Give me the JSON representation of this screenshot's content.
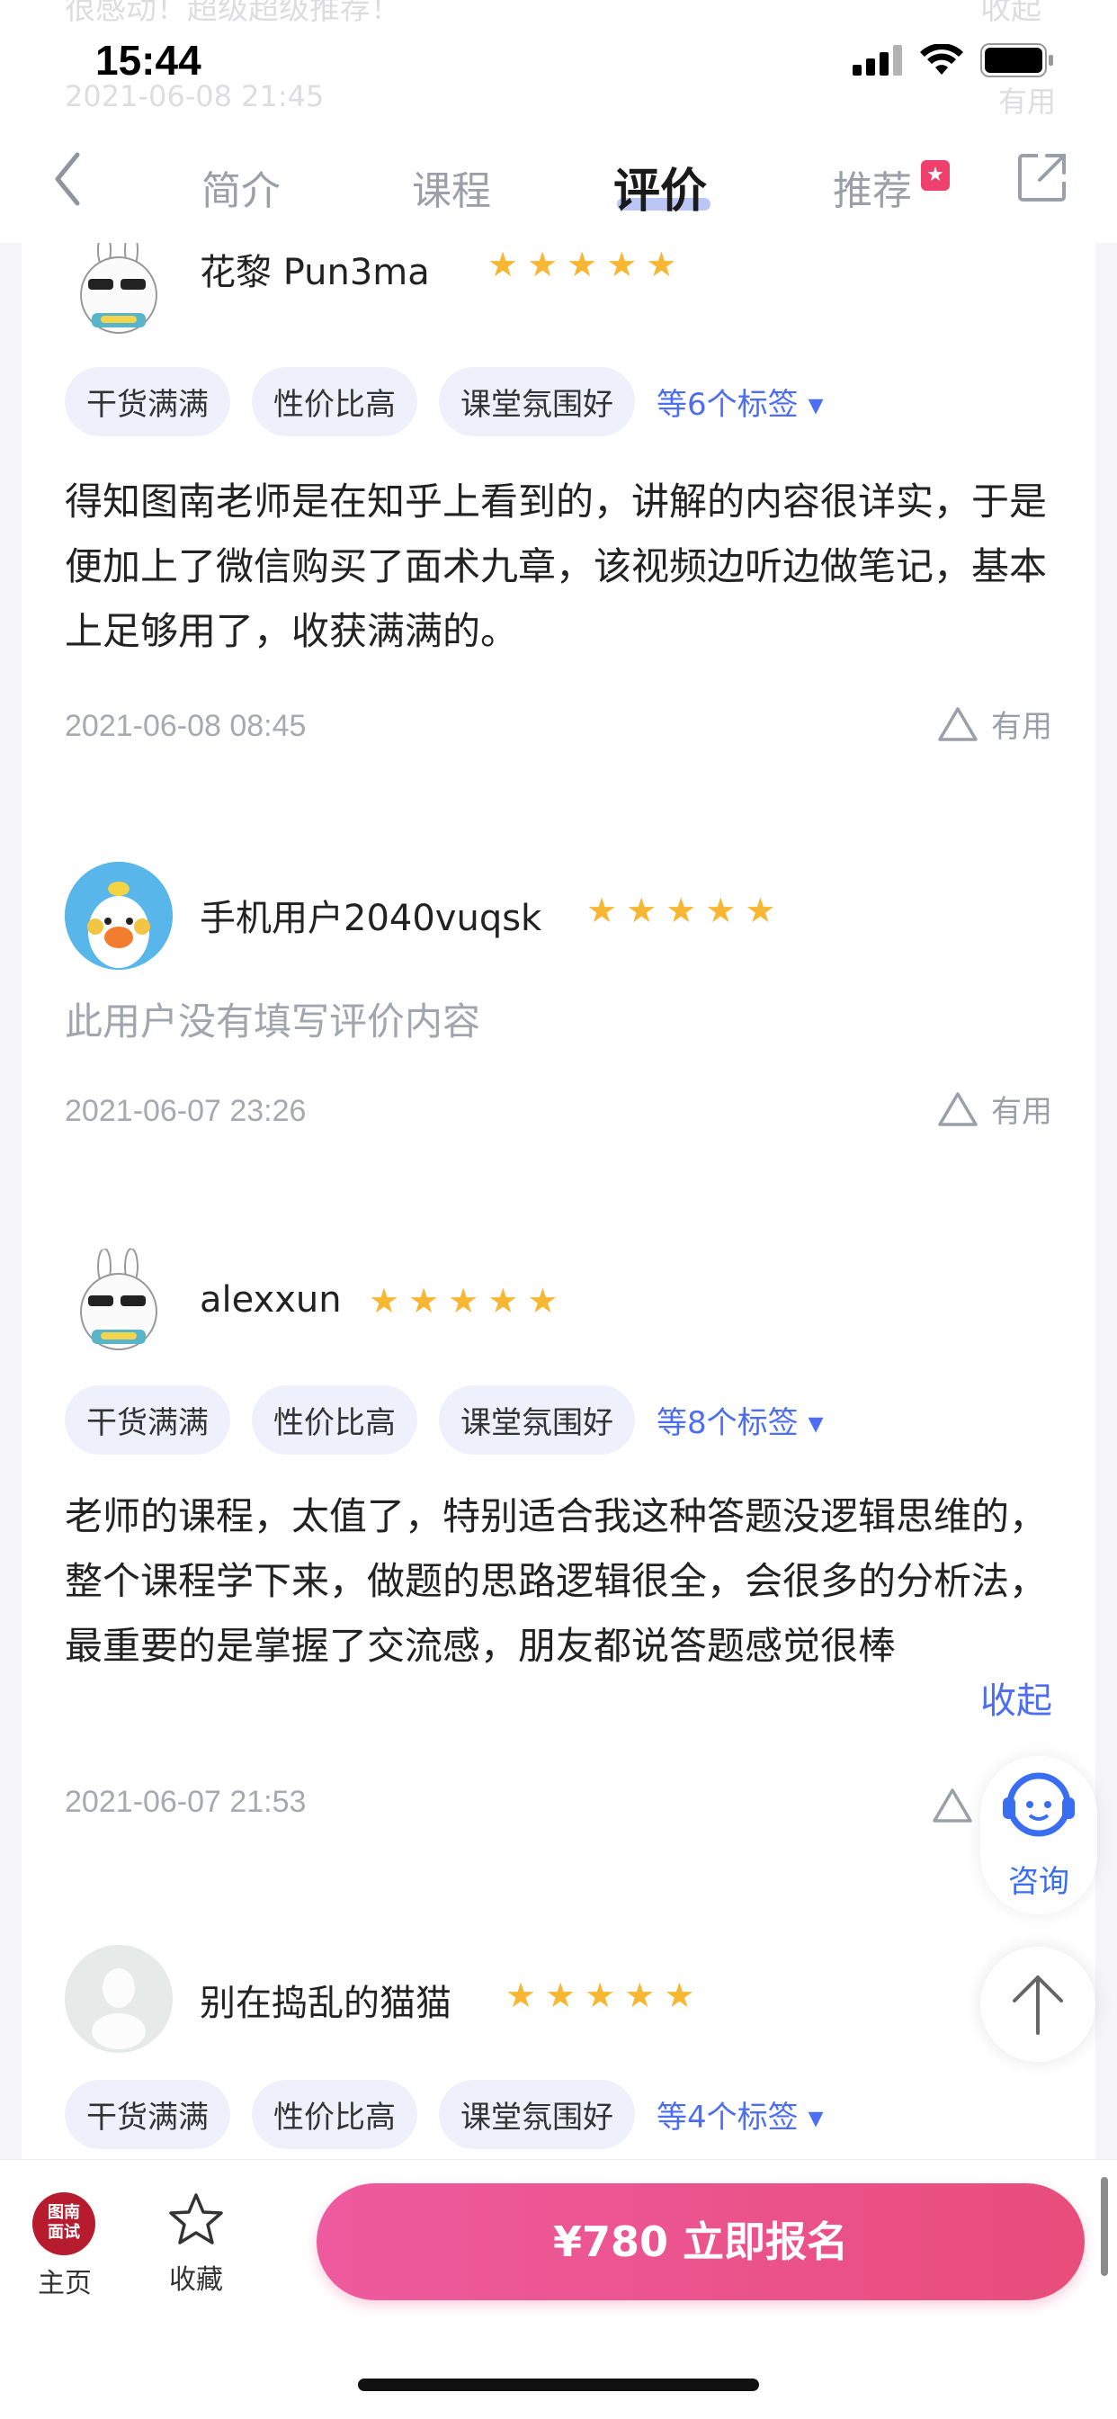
{
  "status_bar": {
    "time": "15:44"
  },
  "ghost": {
    "text": "很感动！超级超级推荐！",
    "action": "收起",
    "date": "2021-06-08 21:45",
    "useful": "有用"
  },
  "nav": {
    "tabs": [
      {
        "label": "简介"
      },
      {
        "label": "课程"
      },
      {
        "label": "评价"
      },
      {
        "label": "推荐"
      }
    ],
    "active_tab": "评价"
  },
  "reviews": [
    {
      "user": "花黎 Pun3ma",
      "rating": 5,
      "tags": [
        "干货满满",
        "性价比高",
        "课堂氛围好"
      ],
      "tags_more": "等6个标签",
      "content": "得知图南老师是在知乎上看到的，讲解的内容很详实，于是便加上了微信购买了面术九章，该视频边听边做笔记，基本上足够用了，收获满满的。",
      "date": "2021-06-08 08:45",
      "useful": "有用"
    },
    {
      "user": "手机用户2040vuqsk",
      "rating": 5,
      "content": "此用户没有填写评价内容",
      "date": "2021-06-07 23:26",
      "useful": "有用"
    },
    {
      "user": "alexxun",
      "rating": 5,
      "tags": [
        "干货满满",
        "性价比高",
        "课堂氛围好"
      ],
      "tags_more": "等8个标签",
      "content": "老师的课程，太值了，特别适合我这种答题没逻辑思维的，整个课程学下来，做题的思路逻辑很全，会很多的分析法，最重要的是掌握了交流感，朋友都说答题感觉很棒",
      "collapse": "收起",
      "date": "2021-06-07 21:53"
    },
    {
      "user": "别在捣乱的猫猫",
      "rating": 5,
      "tags": [
        "干货满满",
        "性价比高",
        "课堂氛围好"
      ],
      "tags_more": "等4个标签"
    }
  ],
  "floating": {
    "consult": "咨询"
  },
  "bottom_bar": {
    "logo_text": "图南面试",
    "home": "主页",
    "favorite": "收藏",
    "cta": "¥780 立即报名"
  },
  "colors": {
    "accent": "#4d6ef2",
    "star": "#f7b733",
    "cta_start": "#ee5a9e",
    "cta_end": "#e84d7b"
  }
}
